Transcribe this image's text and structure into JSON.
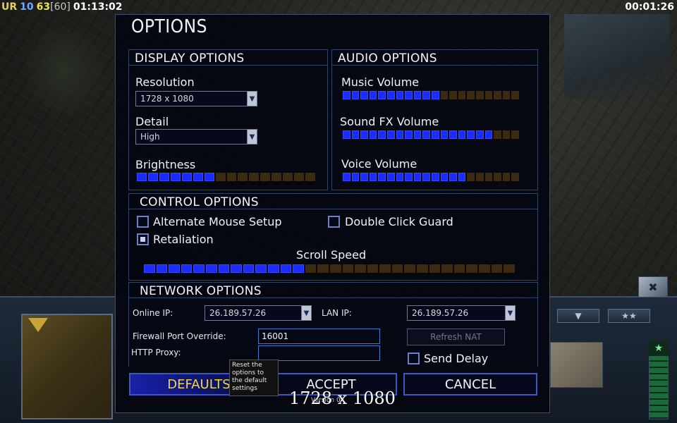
{
  "hud": {
    "tag": "UR",
    "players": "10",
    "fps": "63",
    "fps_max": "[60]",
    "clock": "01:13:02",
    "timer": "00:01:26"
  },
  "dialog": {
    "title": "OPTIONS",
    "display": {
      "header": "DISPLAY OPTIONS",
      "resolution_label": "Resolution",
      "resolution_value": "1728 x 1080",
      "detail_label": "Detail",
      "detail_value": "High",
      "brightness_label": "Brightness",
      "brightness_level": 0.45
    },
    "audio": {
      "header": "AUDIO OPTIONS",
      "music_label": "Music Volume",
      "music_level": 0.55,
      "sfx_label": "Sound FX Volume",
      "sfx_level": 0.85,
      "voice_label": "Voice Volume",
      "voice_level": 0.7
    },
    "control": {
      "header": "CONTROL OPTIONS",
      "alt_mouse_label": "Alternate Mouse Setup",
      "alt_mouse_checked": false,
      "double_click_label": "Double Click Guard",
      "double_click_checked": false,
      "retaliation_label": "Retaliation",
      "retaliation_checked": true,
      "scroll_label": "Scroll Speed",
      "scroll_level": 0.42
    },
    "network": {
      "header": "NETWORK OPTIONS",
      "online_ip_label": "Online IP:",
      "online_ip_value": "26.189.57.26",
      "lan_ip_label": "LAN IP:",
      "lan_ip_value": "26.189.57.26",
      "firewall_label": "Firewall Port Override:",
      "firewall_value": "16001",
      "proxy_label": "HTTP Proxy:",
      "proxy_value": "",
      "refresh_nat_label": "Refresh NAT",
      "send_delay_label": "Send Delay",
      "send_delay_checked": false
    },
    "buttons": {
      "defaults": "DEFAULTS",
      "accept": "ACCEPT",
      "cancel": "CANCEL"
    },
    "tooltip": "Reset the options to the default settings",
    "res_readout": "1728 x 1080",
    "version": "Version 04"
  },
  "colors": {
    "slider_on": "#1a2cff",
    "slider_off": "#3b2a10",
    "panel_border": "#2f4468",
    "defaults_text": "#f0d840"
  }
}
